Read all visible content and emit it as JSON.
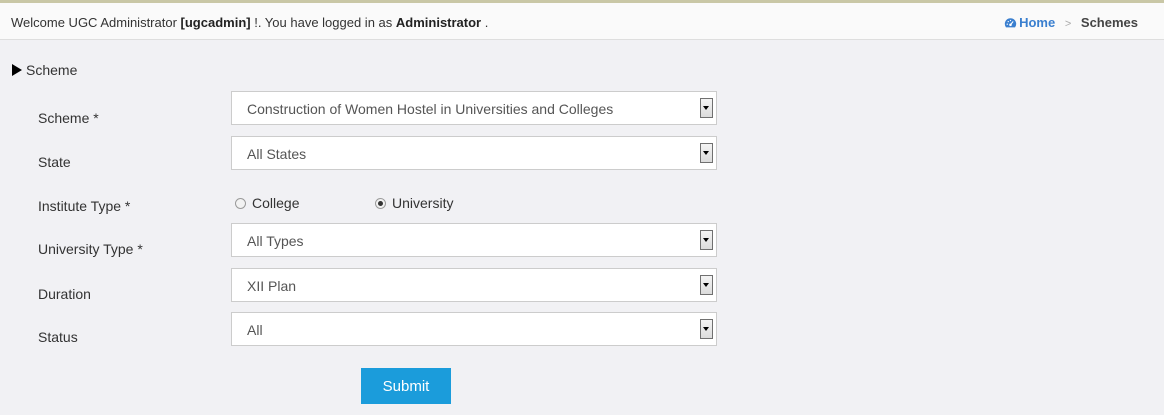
{
  "header": {
    "welcome_prefix": "Welcome UGC Administrator ",
    "username": "[ugcadmin]",
    "welcome_middle": " !. You have logged in as ",
    "role": "Administrator",
    "welcome_suffix": " ."
  },
  "breadcrumb": {
    "home_label": "Home",
    "separator": ">",
    "current": "Schemes"
  },
  "section": {
    "title": "Scheme"
  },
  "form": {
    "scheme": {
      "label": "Scheme *",
      "value": "Construction of Women Hostel in Universities and Colleges"
    },
    "state": {
      "label": "State",
      "value": "All States"
    },
    "institute_type": {
      "label": "Institute Type *",
      "options": [
        {
          "label": "College",
          "selected": false
        },
        {
          "label": "University",
          "selected": true
        }
      ]
    },
    "university_type": {
      "label": "University Type *",
      "value": "All Types"
    },
    "duration": {
      "label": "Duration",
      "value": "XII Plan"
    },
    "status": {
      "label": "Status",
      "value": "All"
    },
    "submit_label": "Submit"
  },
  "colors": {
    "accent": "#1b9cdb",
    "link": "#3a7fcf",
    "background": "#f1f1f4"
  }
}
